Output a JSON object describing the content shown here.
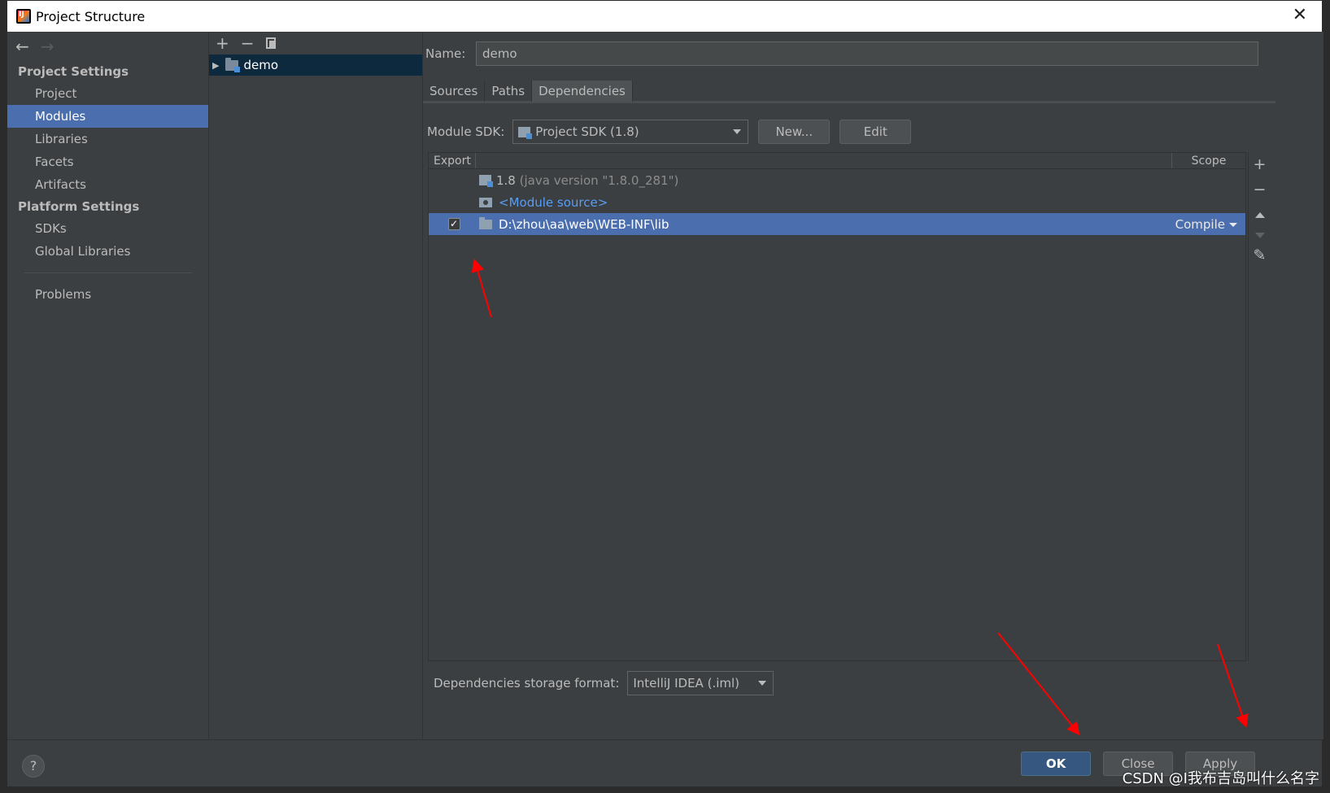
{
  "window": {
    "title": "Project Structure",
    "close_glyph": "✕"
  },
  "nav": {
    "back_glyph": "←",
    "forward_glyph": "→",
    "project_settings_heading": "Project Settings",
    "project_settings_items": [
      "Project",
      "Modules",
      "Libraries",
      "Facets",
      "Artifacts"
    ],
    "selected_item": "Modules",
    "platform_settings_heading": "Platform Settings",
    "platform_settings_items": [
      "SDKs",
      "Global Libraries"
    ],
    "problems": "Problems"
  },
  "module_tree": {
    "add_glyph": "+",
    "remove_glyph": "−",
    "module_name": "demo"
  },
  "module": {
    "name_label": "Name:",
    "name_value": "demo",
    "tabs": [
      "Sources",
      "Paths",
      "Dependencies"
    ],
    "active_tab": "Dependencies",
    "sdk_label": "Module SDK:",
    "sdk_value": "Project SDK (1.8)",
    "new_button": "New...",
    "edit_button": "Edit"
  },
  "dependencies": {
    "columns": {
      "export": "Export",
      "scope": "Scope"
    },
    "rows": [
      {
        "name": "1.8",
        "detail": "(java version \"1.8.0_281\")",
        "scope": ""
      },
      {
        "name": "<Module source>",
        "scope": ""
      },
      {
        "name": "D:\\zhou\\aa\\web\\WEB-INF\\lib",
        "scope": "Compile",
        "exported": true,
        "selected": true
      }
    ],
    "side_add": "+",
    "side_remove": "−",
    "storage_label": "Dependencies storage format:",
    "storage_value": "IntelliJ IDEA (.iml)"
  },
  "footer": {
    "help": "?",
    "ok": "OK",
    "close": "Close",
    "apply": "Apply"
  },
  "watermark": "CSDN @I我布吉岛叫什么名字",
  "colors": {
    "selection": "#4b6eaf",
    "annotation_arrow": "#ff0000",
    "link": "#589df6"
  }
}
